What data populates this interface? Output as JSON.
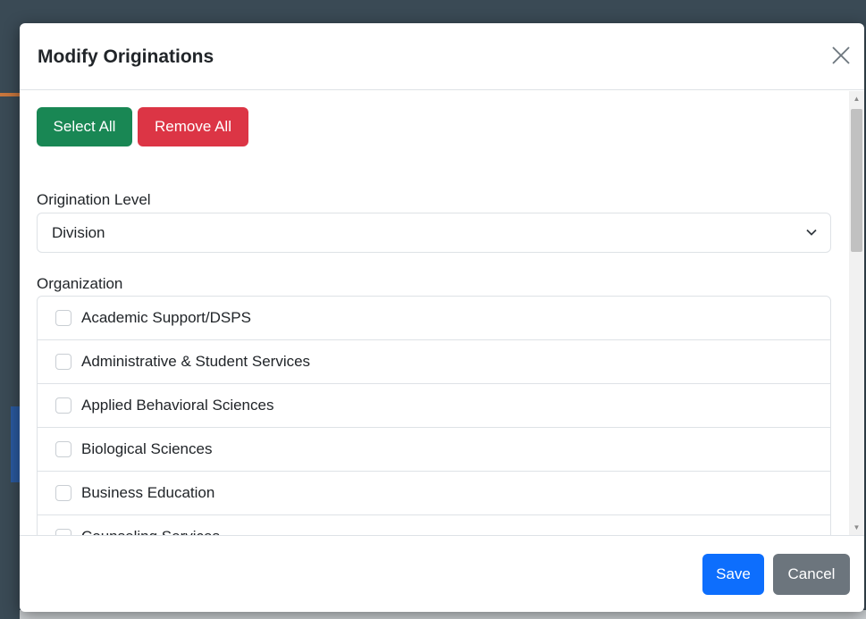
{
  "modal": {
    "title": "Modify Originations",
    "close_icon": "close-icon"
  },
  "actions": {
    "select_all": "Select All",
    "remove_all": "Remove All"
  },
  "origination_level": {
    "label": "Origination Level",
    "value": "Division",
    "icon": "chevron-down-icon"
  },
  "organization": {
    "label": "Organization",
    "items": [
      {
        "label": "Academic Support/DSPS",
        "checked": false
      },
      {
        "label": "Administrative & Student Services",
        "checked": false
      },
      {
        "label": "Applied Behavioral Sciences",
        "checked": false
      },
      {
        "label": "Biological Sciences",
        "checked": false
      },
      {
        "label": "Business Education",
        "checked": false
      },
      {
        "label": "Counseling Services",
        "checked": false
      }
    ]
  },
  "footer": {
    "save": "Save",
    "cancel": "Cancel"
  },
  "colors": {
    "success": "#198754",
    "danger": "#dc3545",
    "primary": "#0d6efd",
    "secondary": "#6c757d"
  }
}
